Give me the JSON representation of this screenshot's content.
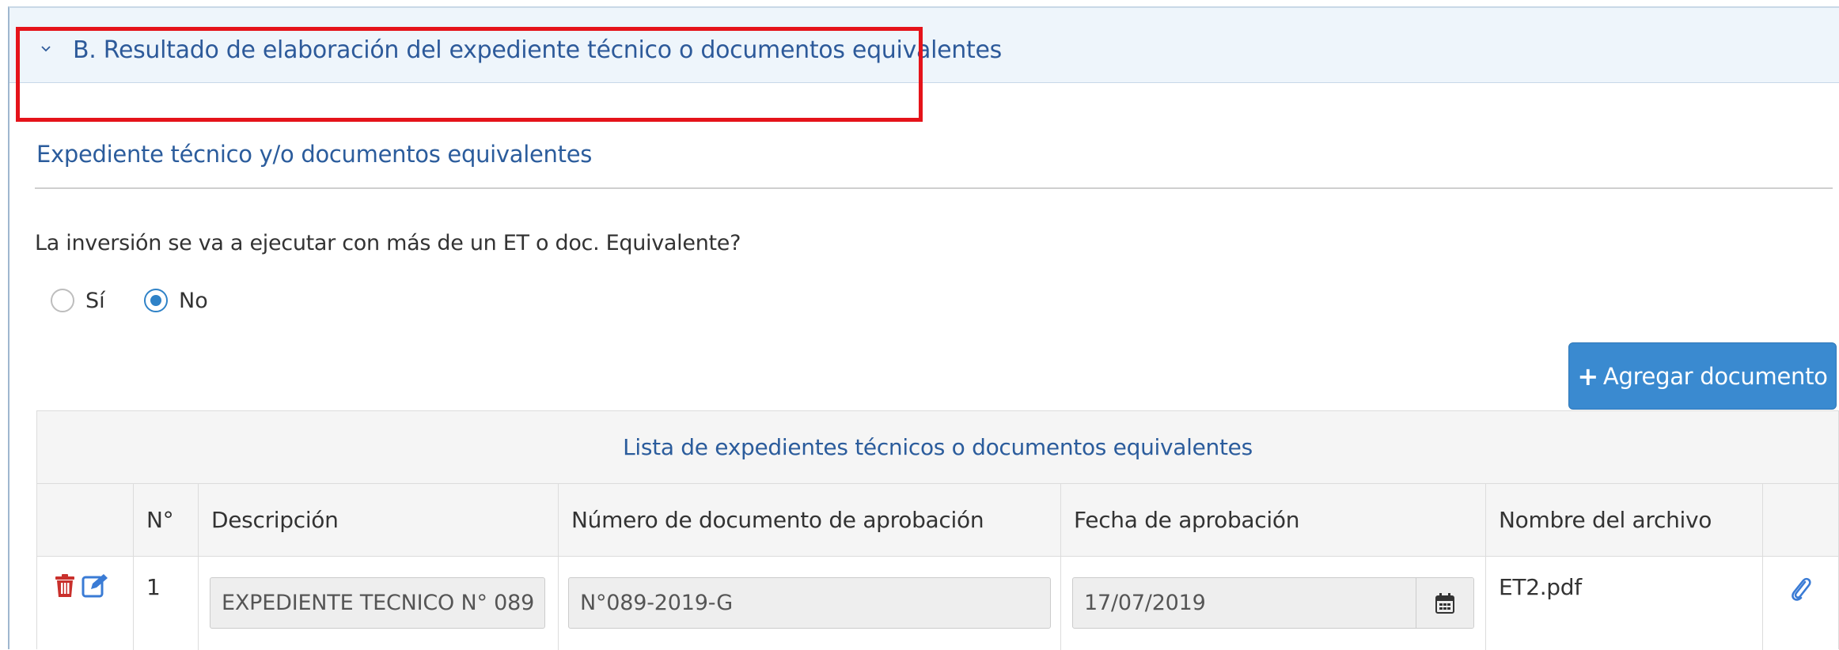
{
  "section": {
    "header_title": "B. Resultado de elaboración del expediente técnico o documentos equivalentes",
    "subtitle": "Expediente técnico y/o documentos equivalentes",
    "question": "La inversión se va a ejecutar con más de un ET o doc. Equivalente?",
    "radio_options": [
      {
        "label": "Sí",
        "checked": false
      },
      {
        "label": "No",
        "checked": true
      }
    ]
  },
  "add_button": {
    "label": "Agregar documento",
    "icon": "plus-icon"
  },
  "table": {
    "caption": "Lista de expedientes técnicos o documentos equivalentes",
    "headers": [
      "",
      "N°",
      "Descripción",
      "Número de documento de aprobación",
      "Fecha de aprobación",
      "Nombre del archivo",
      ""
    ],
    "rows": [
      {
        "number": "1",
        "description": "EXPEDIENTE TECNICO N° 089",
        "approval_doc_number": "N°089-2019-G",
        "approval_date": "17/07/2019",
        "file_name": "ET2.pdf",
        "actions": [
          "trash-icon",
          "edit-icon"
        ],
        "attach_icon": "paperclip-icon"
      }
    ]
  },
  "colors": {
    "header_bg": "#eef5fb",
    "title_blue": "#2d5a9a",
    "highlight_red": "#e5131a",
    "button_blue": "#3a8ad0",
    "delete_red": "#c9302c",
    "radio_blue": "#2f82c7"
  }
}
